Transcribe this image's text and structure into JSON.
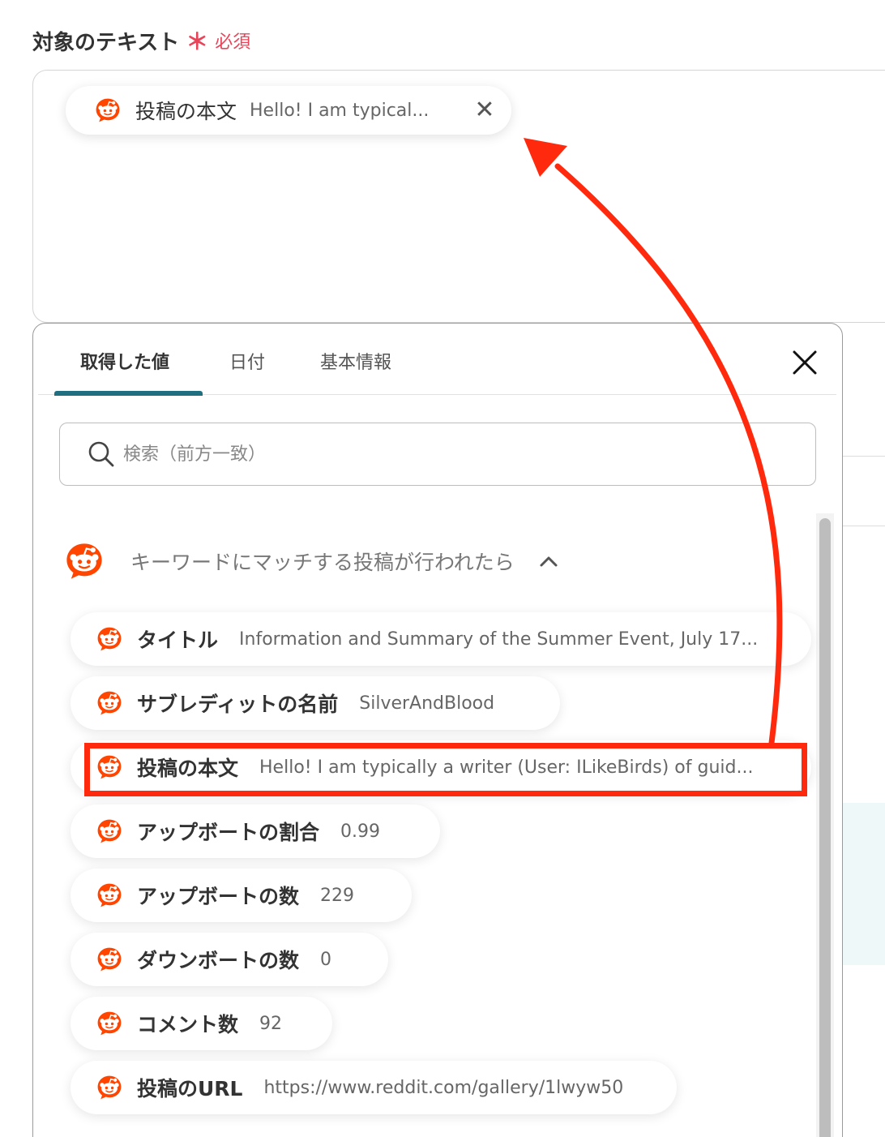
{
  "field": {
    "label": "対象のテキスト",
    "required_mark": "＊",
    "required_text": "必須"
  },
  "selected_chip": {
    "icon": "reddit-icon",
    "label": "投稿の本文",
    "value": "Hello! I am typical..."
  },
  "picker": {
    "tabs": [
      {
        "label": "取得した値",
        "active": true
      },
      {
        "label": "日付",
        "active": false
      },
      {
        "label": "基本情報",
        "active": false
      }
    ],
    "search_placeholder": "検索（前方一致）",
    "group": {
      "icon": "reddit-icon",
      "title": "キーワードにマッチする投稿が行われたら",
      "expanded": true
    },
    "items": [
      {
        "label": "タイトル",
        "value": "Information and Summary of the Summer Event, July 17..."
      },
      {
        "label": "サブレディットの名前",
        "value": "SilverAndBlood"
      },
      {
        "label": "投稿の本文",
        "value": "Hello! I am typically a writer (User: ILikeBirds) of guid...",
        "highlighted": true
      },
      {
        "label": "アップボートの割合",
        "value": "0.99"
      },
      {
        "label": "アップボートの数",
        "value": "229"
      },
      {
        "label": "ダウンボートの数",
        "value": "0"
      },
      {
        "label": "コメント数",
        "value": "92"
      },
      {
        "label": "投稿のURL",
        "value": "https://www.reddit.com/gallery/1lwyw50"
      }
    ]
  },
  "colors": {
    "required": "#e8455a",
    "tab_indicator": "#1f6f80",
    "reddit": "#ff4500",
    "annotation": "#ff2a0d"
  }
}
